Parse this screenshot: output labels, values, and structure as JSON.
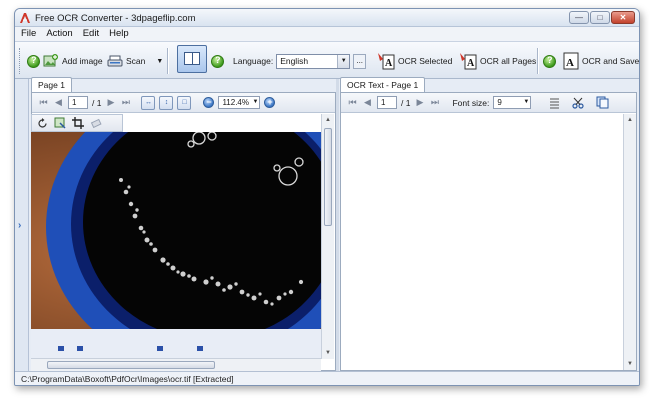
{
  "window": {
    "title": "Free OCR Converter - 3dpageflip.com"
  },
  "window_buttons": {
    "minimize": "—",
    "maximize": "□",
    "close": "✕"
  },
  "menu": [
    "File",
    "Action",
    "Edit",
    "Help"
  ],
  "toolbar": {
    "add_image": "Add image",
    "scan": "Scan",
    "scan_dropdown": "▼",
    "language_label": "Language:",
    "language_value": "English",
    "language_more": "...",
    "ocr_selected": "OCR Selected",
    "ocr_all_pages": "OCR all Pages",
    "ocr_and_save": "OCR and Save"
  },
  "left_panel": {
    "tab": "Page 1",
    "page_current": "1",
    "page_total": "/ 1",
    "zoom": "112.4%"
  },
  "right_panel": {
    "tab": "OCR Text - Page 1",
    "page_current": "1",
    "page_total": "/ 1",
    "font_size_label": "Font size:",
    "font_size_value": "9"
  },
  "status": {
    "path": "C:\\ProgramData\\Boxoft\\PdfOcr\\Images\\ocr.tif [Extracted]"
  }
}
